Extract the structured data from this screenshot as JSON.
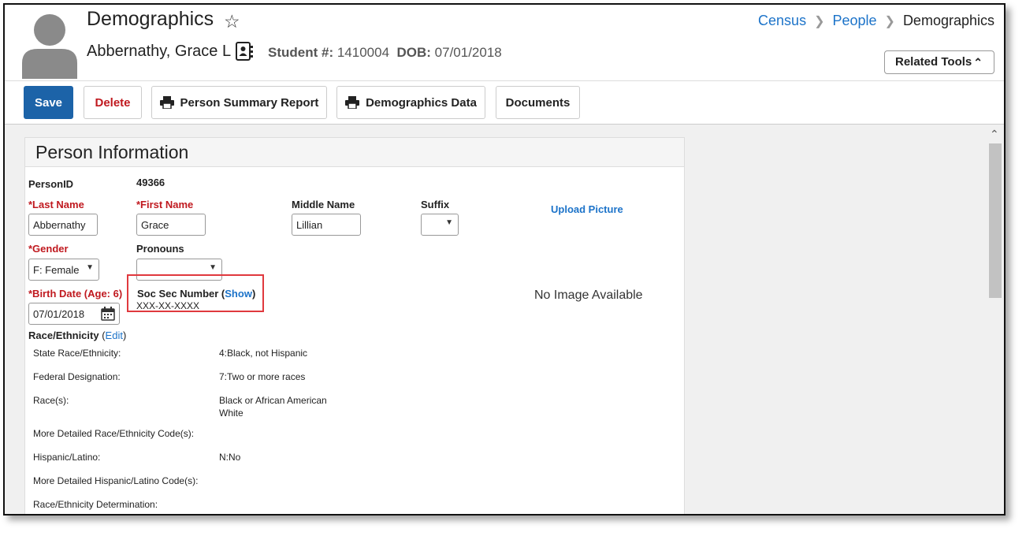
{
  "header": {
    "title": "Demographics",
    "student_name": "Abbernathy, Grace L",
    "student_num_label": "Student #:",
    "student_num": "1410004",
    "dob_label": "DOB:",
    "dob": "07/01/2018",
    "breadcrumb": [
      "Census",
      "People",
      "Demographics"
    ],
    "related_tools": "Related Tools"
  },
  "toolbar": {
    "save": "Save",
    "delete": "Delete",
    "person_summary": "Person Summary Report",
    "demographics_data": "Demographics Data",
    "documents": "Documents"
  },
  "panel": {
    "title": "Person Information",
    "person_id_label": "PersonID",
    "person_id": "49366",
    "last_name_label": "*Last Name",
    "last_name": "Abbernathy",
    "first_name_label": "*First Name",
    "first_name": "Grace",
    "middle_name_label": "Middle Name",
    "middle_name": "Lillian",
    "suffix_label": "Suffix",
    "suffix": "",
    "upload_picture": "Upload Picture",
    "gender_label": "*Gender",
    "gender": "F: Female",
    "pronouns_label": "Pronouns",
    "pronouns": "",
    "birth_date_label": "*Birth Date (Age: 6)",
    "birth_date": "07/01/2018",
    "ssn_label": "Soc Sec Number (",
    "ssn_show": "Show",
    "ssn_close": ")",
    "ssn_value": "XXX-XX-XXXX",
    "no_image": "No Image Available",
    "race_label": "Race/Ethnicity",
    "race_edit_open": " (",
    "race_edit": "Edit",
    "race_edit_close": ")",
    "race_rows": [
      {
        "label": "State Race/Ethnicity:",
        "value": "4:Black, not Hispanic"
      },
      {
        "label": "Federal Designation:",
        "value": "7:Two or more races"
      },
      {
        "label": "Race(s):",
        "value": "Black or African American",
        "value2": "White"
      },
      {
        "label": "More Detailed Race/Ethnicity Code(s):",
        "value": ""
      },
      {
        "label": "Hispanic/Latino:",
        "value": "N:No"
      },
      {
        "label": "More Detailed Hispanic/Latino Code(s):",
        "value": ""
      },
      {
        "label": "Race/Ethnicity Determination:",
        "value": ""
      }
    ]
  }
}
